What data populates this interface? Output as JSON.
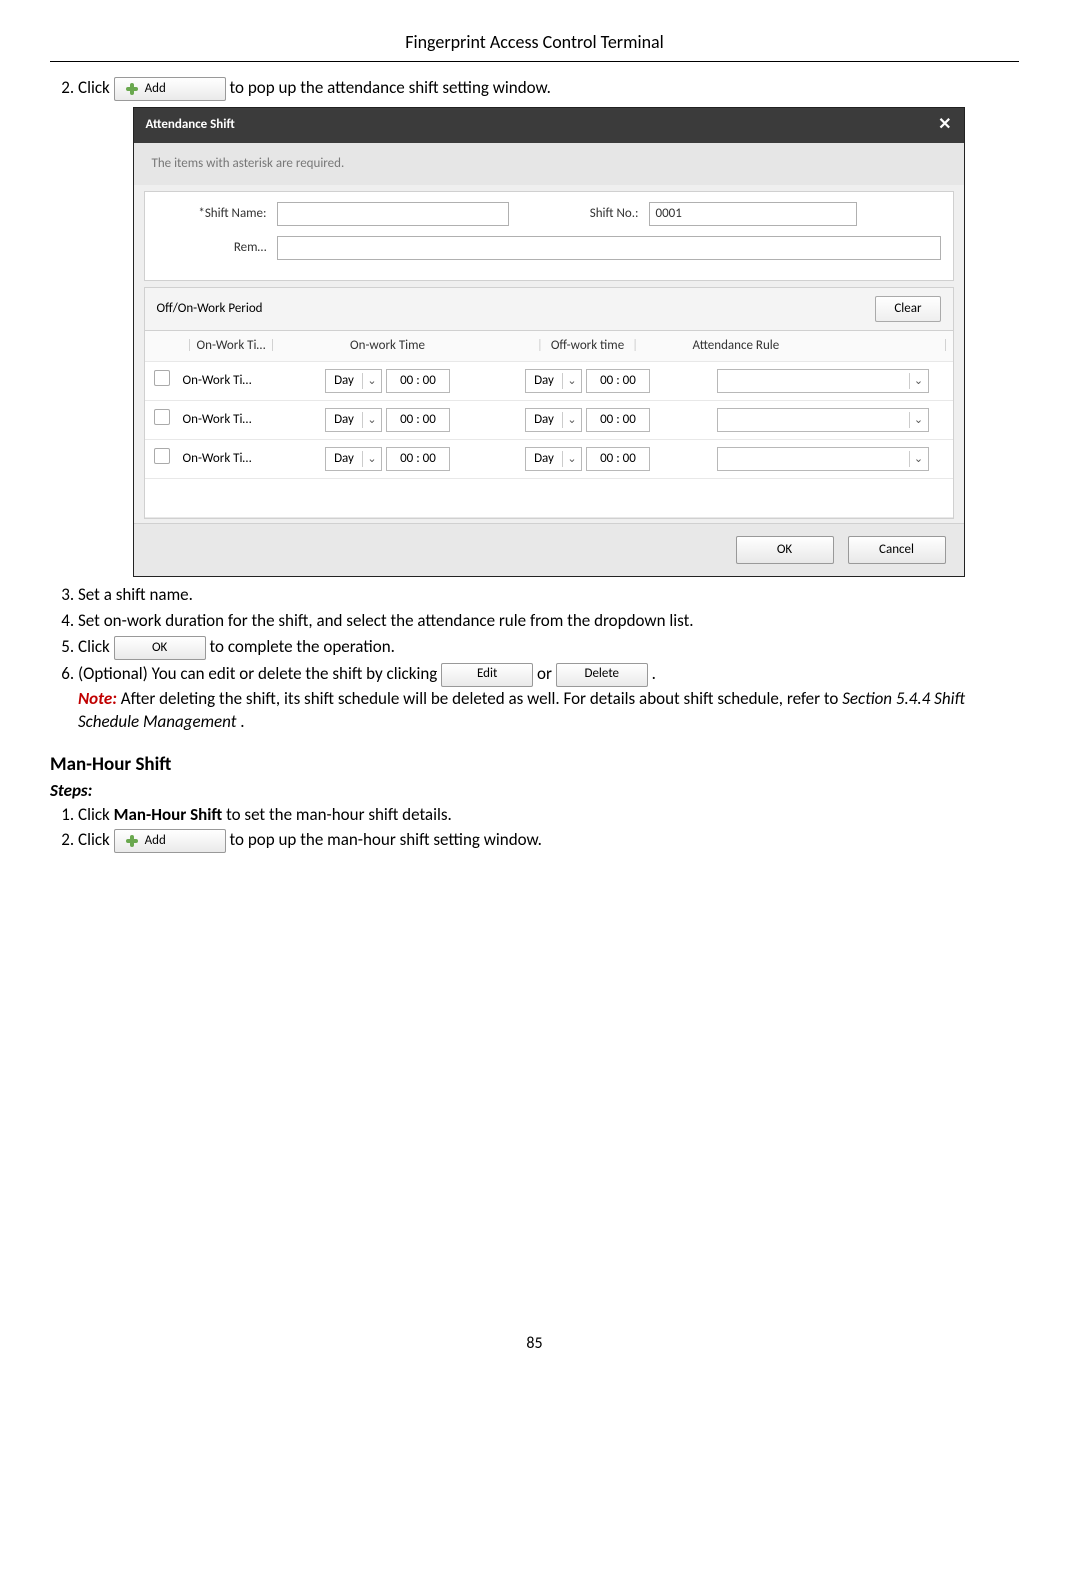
{
  "page": {
    "header": "Fingerprint Access Control Terminal",
    "number": "85"
  },
  "steps_top": {
    "s2_pre": "Click ",
    "s2_post": " to pop up the attendance shift setting window.",
    "s3": "Set a shift name.",
    "s4": "Set on-work duration for the shift, and select the attendance rule from the dropdown list.",
    "s5_pre": "Click ",
    "s5_post": " to complete the operation.",
    "s6_pre": "(Optional) You can edit or delete the shift by clicking ",
    "s6_mid": " or ",
    "s6_post": ".",
    "note_label": "Note:",
    "note_text": " After deleting the shift, its shift schedule will be deleted as well. For details about shift schedule, refer to ",
    "note_ref": "Section 5.4.4 Shift Schedule Management",
    "note_end": "."
  },
  "buttons": {
    "add": "Add",
    "ok": "OK",
    "edit": "Edit",
    "delete": "Delete"
  },
  "modal": {
    "title": "Attendance Shift",
    "hint": "The items with asterisk are required.",
    "shift_name_label": "*Shift Name:",
    "shift_no_label": "Shift No.:",
    "shift_no_value": "0001",
    "rem_label": "Rem…",
    "section_title": "Off/On-Work Period",
    "clear": "Clear",
    "cols": {
      "name": "On-Work Ti…",
      "ontime": "On-work Time",
      "offtime": "Off-work time",
      "rule": "Attendance Rule"
    },
    "rows": [
      {
        "name": "On-Work Ti…",
        "day1": "Day",
        "t1": "00 : 00",
        "day2": "Day",
        "t2": "00 : 00"
      },
      {
        "name": "On-Work Ti…",
        "day1": "Day",
        "t1": "00 : 00",
        "day2": "Day",
        "t2": "00 : 00"
      },
      {
        "name": "On-Work Ti…",
        "day1": "Day",
        "t1": "00 : 00",
        "day2": "Day",
        "t2": "00 : 00"
      }
    ],
    "ok": "OK",
    "cancel": "Cancel"
  },
  "manhour": {
    "heading": "Man-Hour Shift",
    "steps_label": "Steps:",
    "s1_pre": "Click ",
    "s1_bold": "Man-Hour Shift",
    "s1_post": " to set the man-hour shift details.",
    "s2_pre": "Click ",
    "s2_post": " to pop up the man-hour shift setting window."
  }
}
